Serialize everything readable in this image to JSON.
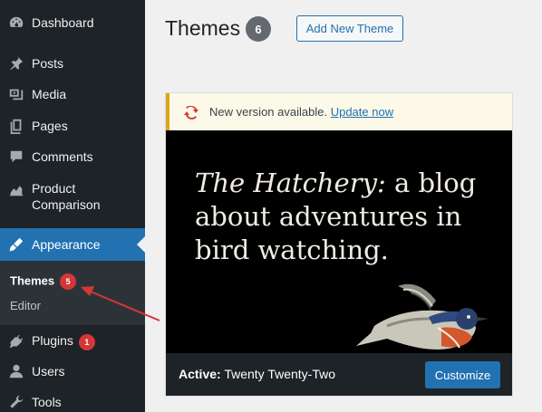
{
  "sidebar": {
    "items": [
      {
        "label": "Dashboard",
        "icon": "dashboard-icon"
      },
      {
        "label": "Posts",
        "icon": "pin-icon"
      },
      {
        "label": "Media",
        "icon": "media-icon"
      },
      {
        "label": "Pages",
        "icon": "pages-icon"
      },
      {
        "label": "Comments",
        "icon": "comment-icon"
      },
      {
        "label_line1": "Product",
        "label_line2": "Comparison",
        "icon": "chart-icon"
      },
      {
        "label": "Appearance",
        "icon": "brush-icon"
      },
      {
        "label": "Plugins",
        "icon": "plug-icon",
        "badge": "1"
      },
      {
        "label": "Users",
        "icon": "user-icon"
      },
      {
        "label": "Tools",
        "icon": "wrench-icon"
      }
    ],
    "submenu": [
      {
        "label": "Themes",
        "badge": "5"
      },
      {
        "label": "Editor"
      }
    ]
  },
  "header": {
    "title": "Themes",
    "count": "6",
    "add_button": "Add New Theme"
  },
  "theme": {
    "notice_text": "New version available.",
    "notice_link": "Update now",
    "tagline_italic": "The Hatchery:",
    "tagline_rest": " a blog about adventures in bird watching.",
    "active_prefix": "Active:",
    "active_name": " Twenty Twenty-Two",
    "customize_button": "Customize"
  },
  "colors": {
    "sidebar_bg": "#1d2327",
    "accent": "#2271b1",
    "badge": "#d63638",
    "notice_border": "#dba617",
    "annotation_arrow": "#d63638"
  }
}
